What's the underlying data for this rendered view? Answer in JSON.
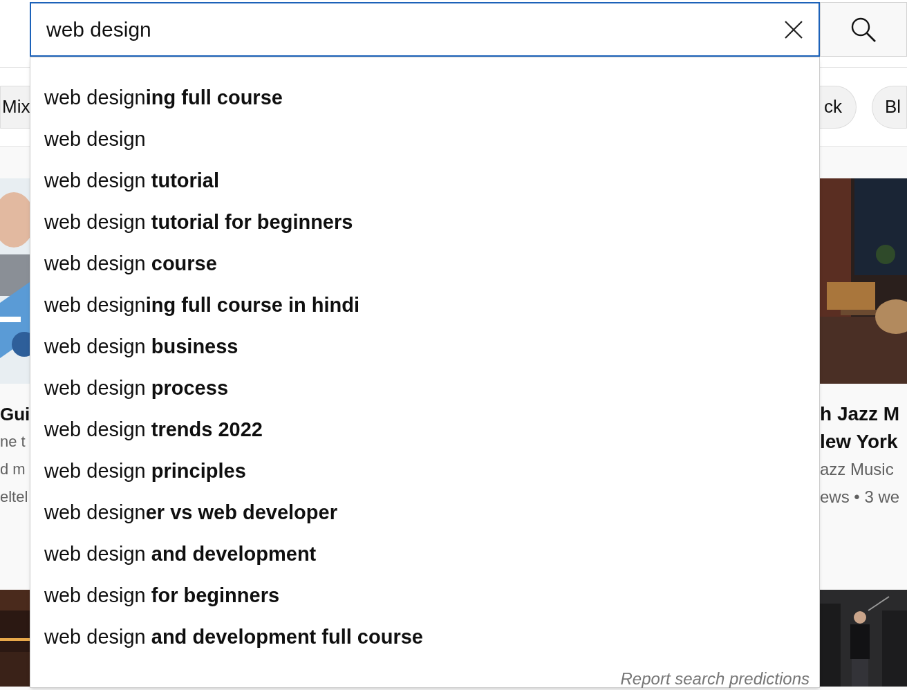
{
  "search": {
    "value": "web design"
  },
  "chips": [
    {
      "label": "Mix"
    },
    {
      "label": "ck"
    },
    {
      "label": "Bl"
    }
  ],
  "suggestions": [
    "web design**ing full course**",
    "web design",
    "web design **tutorial**",
    "web design **tutorial for beginners**",
    "web design **course**",
    "web design**ing full course in hindi**",
    "web design **business**",
    "web design **process**",
    "web design **trends 2022**",
    "web design **principles**",
    "web design**er vs web developer**",
    "web design **and development**",
    "web design **for beginners**",
    "web design **and development full course**"
  ],
  "report_link": "Report search predictions",
  "videos": [
    {
      "lines": [
        {
          "kind": "title",
          "text": "Gui"
        },
        {
          "kind": "meta",
          "text": "ne t"
        },
        {
          "kind": "meta",
          "text": "d m"
        },
        {
          "kind": "meta",
          "text": "eltel"
        }
      ]
    },
    {
      "lines": [
        {
          "kind": "title",
          "text": "h Jazz M"
        },
        {
          "kind": "title",
          "text": "lew York"
        },
        {
          "kind": "meta",
          "text": "azz Music"
        },
        {
          "kind": "meta",
          "text": "ews • 3 we"
        }
      ]
    }
  ]
}
